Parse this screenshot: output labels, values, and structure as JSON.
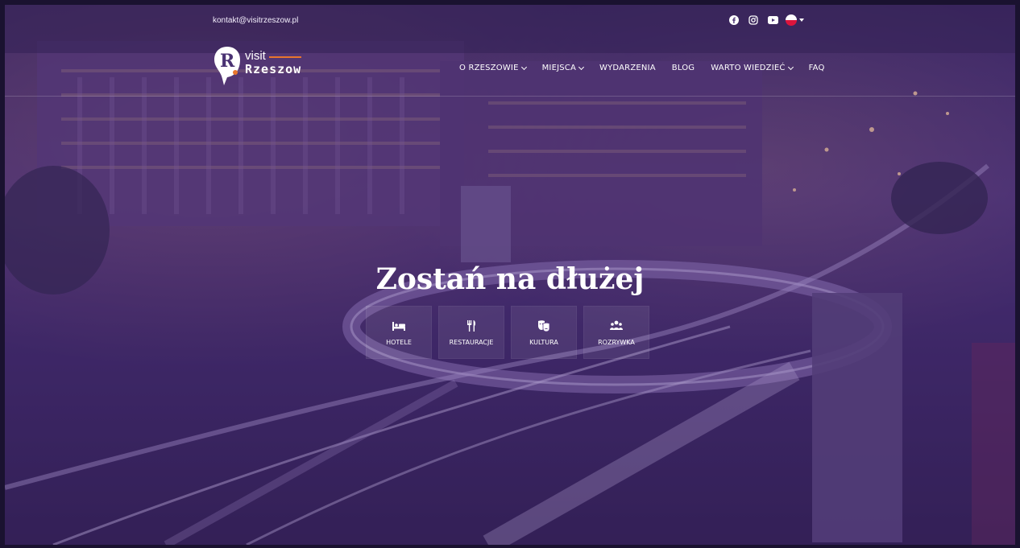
{
  "topbar": {
    "contact_email": "kontakt@visitrzeszow.pl",
    "socials": [
      {
        "name": "facebook-icon"
      },
      {
        "name": "instagram-icon"
      },
      {
        "name": "youtube-icon"
      }
    ],
    "language": {
      "flag": "poland-flag-icon"
    }
  },
  "logo": {
    "word_visit": "visit",
    "word_city": "Rzeszow"
  },
  "nav": {
    "items": [
      {
        "label": "O RZESZOWIE",
        "dropdown": true
      },
      {
        "label": "MIEJSCA",
        "dropdown": true
      },
      {
        "label": "WYDARZENIA",
        "dropdown": false
      },
      {
        "label": "BLOG",
        "dropdown": false
      },
      {
        "label": "WARTO WIEDZIEĆ",
        "dropdown": true
      },
      {
        "label": "FAQ",
        "dropdown": false
      }
    ]
  },
  "hero": {
    "headline": "Zostań na dłużej",
    "categories": [
      {
        "label": "HOTELE",
        "icon": "bed-icon"
      },
      {
        "label": "RESTAURACJE",
        "icon": "utensils-icon"
      },
      {
        "label": "KULTURA",
        "icon": "theater-masks-icon"
      },
      {
        "label": "ROZRYWKA",
        "icon": "people-group-icon"
      }
    ]
  },
  "colors": {
    "accent": "#e8762d",
    "overlay": "#462878",
    "text": "#ffffff"
  }
}
